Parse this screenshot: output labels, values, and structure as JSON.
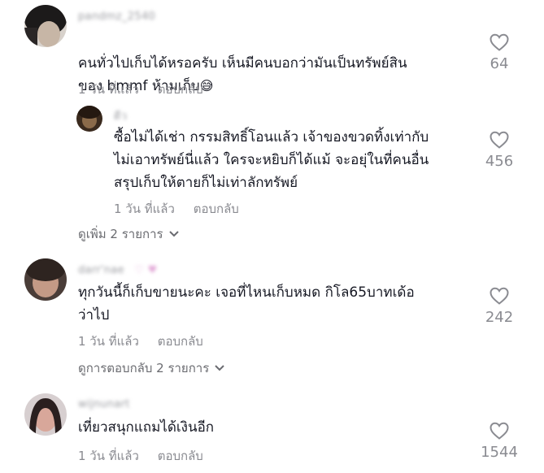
{
  "comments": [
    {
      "username": "pandmz_2540",
      "text": "คนทั่วไปเก็บได้หรอครับ เห็นมีคนบอกว่ามันเป็นทรัพย์สิน\nของ bmmf ห้ามเก็บ",
      "emoji": "😅",
      "time": "1 วัน ที่แล้ว",
      "reply_label": "ตอบกลับ",
      "likes": "64",
      "reply": {
        "username": "ดีว",
        "text": "ซื้อไม่ได้เช่า กรรมสิทธิ์โอนแล้ว เจ้าของขวดทิ้งเท่ากับ\nไม่เอาทรัพย์นี่แล้ว ใครจะหยิบก็ได้แม้ จะอยุ่ในที่คนอื่น\nสรุปเก็บให้ตายก็ไม่เท่าลักทรัพย์",
        "time": "1 วัน ที่แล้ว",
        "reply_label": "ตอบกลับ",
        "likes": "456"
      },
      "more_label": "ดูเพิ่ม 2 รายการ"
    },
    {
      "username": "darr'nae",
      "text": "ทุกวันนี้ก็เก็บขายนะคะ เจอที่ไหนเก็บหมด กิโล65บาทเด้อ\nว่าไป",
      "time": "1 วัน ที่แล้ว",
      "reply_label": "ตอบกลับ",
      "likes": "242",
      "more_label": "ดูการตอบกลับ 2 รายการ"
    },
    {
      "username": "wijnunart",
      "text": "เที่ยวสนุกแถมได้เงินอีก",
      "time": "1 วัน ที่แล้ว",
      "reply_label": "ตอบกลับ",
      "likes": "1544"
    }
  ],
  "colors": {
    "text": "#161823",
    "muted": "#8a8b91"
  }
}
